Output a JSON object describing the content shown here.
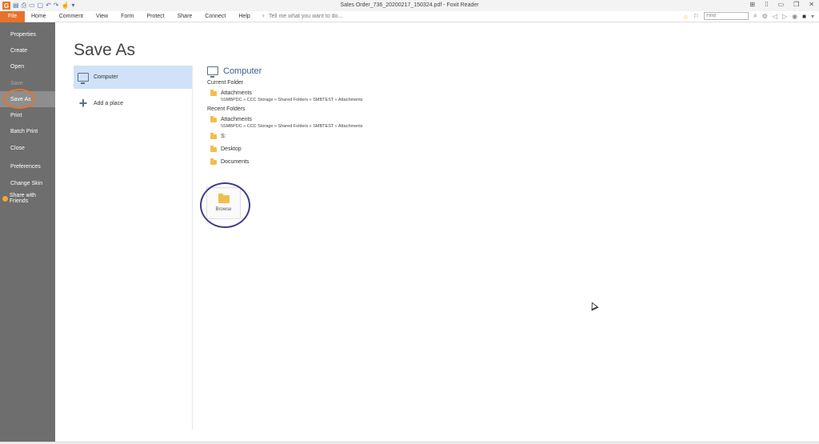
{
  "window": {
    "title": "Sales Order_736_20200217_150324.pdf - Foxit Reader",
    "app_logo": "G",
    "qat_icons": [
      "save-icon",
      "print-icon",
      "new-icon",
      "open-icon",
      "undo-icon",
      "redo-icon",
      "hand-icon",
      "dropdown-icon"
    ]
  },
  "menu": {
    "file": "File",
    "items": [
      "Home",
      "Comment",
      "View",
      "Form",
      "Protect",
      "Share",
      "Connect",
      "Help"
    ],
    "tell_me": "Tell me what you want to do...",
    "find_placeholder": "Find"
  },
  "sidebar": {
    "items": [
      {
        "label": "Properties",
        "state": "normal"
      },
      {
        "label": "Create",
        "state": "normal"
      },
      {
        "label": "Open",
        "state": "normal"
      },
      {
        "label": "Save",
        "state": "disabled"
      },
      {
        "label": "Save As",
        "state": "active"
      },
      {
        "label": "Print",
        "state": "normal"
      },
      {
        "label": "Batch Print",
        "state": "normal"
      },
      {
        "label": "Close",
        "state": "normal"
      },
      {
        "label": "Preferences",
        "state": "normal"
      },
      {
        "label": "Change Skin",
        "state": "normal"
      },
      {
        "label": "Share with Friends",
        "state": "normal"
      }
    ]
  },
  "page": {
    "title": "Save As"
  },
  "places": {
    "computer": "Computer",
    "add_place": "Add a place"
  },
  "detail": {
    "title": "Computer",
    "current_folder_label": "Current Folder",
    "current_folder": {
      "name": "Attachments",
      "path": "\\\\SMBPDC » CCC Storage » Shared Folders » SMBTEST » Attachments"
    },
    "recent_folders_label": "Recent Folders",
    "recent_folders": [
      {
        "name": "Attachments",
        "path": "\\\\SMBPDC » CCC Storage » Shared Folders » SMBTEST » Attachments"
      },
      {
        "name": "S:",
        "path": ""
      },
      {
        "name": "Desktop",
        "path": ""
      },
      {
        "name": "Documents",
        "path": ""
      }
    ],
    "browse": "Browse"
  },
  "colors": {
    "accent": "#e8722a",
    "sidebar_bg": "#6e6e6e",
    "selected_bg": "#cfe2f7",
    "annotation_circle": "#3e3d8c"
  }
}
